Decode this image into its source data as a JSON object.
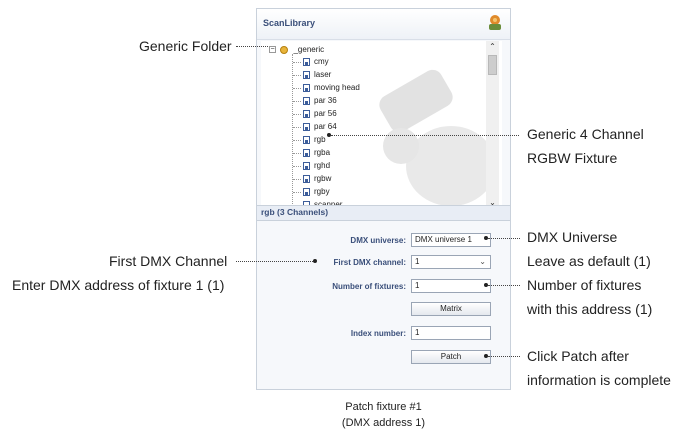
{
  "library": {
    "title": "ScanLibrary",
    "folder_name": "_generic",
    "items": [
      "cmy",
      "laser",
      "moving head",
      "par 36",
      "par 56",
      "par 64",
      "rgb",
      "rgba",
      "rghd",
      "rgbw",
      "rgby",
      "scanner"
    ],
    "selection": "rgb (3 Channels)"
  },
  "form": {
    "dmx_universe_label": "DMX universe:",
    "dmx_universe_value": "DMX universe 1",
    "first_channel_label": "First DMX channel:",
    "first_channel_value": "1",
    "fixtures_label": "Number of fixtures:",
    "fixtures_value": "1",
    "matrix_button": "Matrix",
    "index_label": "Index number:",
    "index_value": "1",
    "patch_button": "Patch"
  },
  "callouts": {
    "generic_folder": "Generic Folder",
    "generic_fixture_line1": "Generic 4 Channel",
    "generic_fixture_line2": "RGBW Fixture",
    "dmx_universe_line1": "DMX Universe",
    "dmx_universe_line2": "Leave as default (1)",
    "first_channel_line1": "First DMX Channel",
    "first_channel_line2": "Enter DMX address of fixture 1 (1)",
    "fixtures_line1": "Number of fixtures",
    "fixtures_line2": "with this address (1)",
    "patch_line1": "Click Patch after",
    "patch_line2": "information is complete"
  },
  "caption": {
    "line1": "Patch fixture #1",
    "line2": "(DMX address 1)"
  }
}
